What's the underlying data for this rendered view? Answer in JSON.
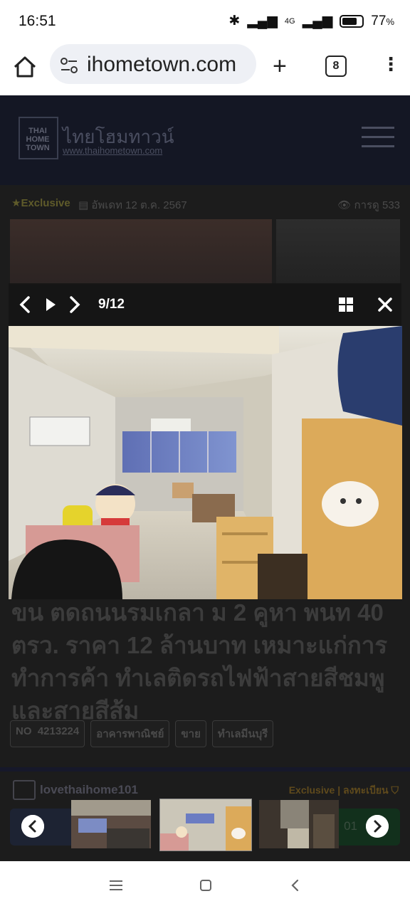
{
  "status": {
    "time": "16:51",
    "battery": "77",
    "battery_suffix": "%",
    "network": "4G"
  },
  "browser": {
    "url": "ihometown.com",
    "tab_count": "8"
  },
  "site": {
    "logo_line1": "THAI",
    "logo_line2": "HOME",
    "logo_line3": "TOWN",
    "name_th": "ไทยโฮมทาวน์",
    "url": "www.thaihometown.com"
  },
  "listing": {
    "exclusive_label": "Exclusive",
    "post_date": "อัพเดท 12 ต.ค. 2567",
    "views": "การดู 533",
    "title_lines": [
      "ขน ตดถนนรมเกลา ม 2 คูหา พนท 40",
      "ตรว. ราคา 12 ล้านบาท เหมาะแก่การ",
      "ทำการค้า ทำเลติดรถไฟฟ้าสายสีชมพู",
      "และสายสีส้ม"
    ],
    "tags": [
      "NO",
      "4213224",
      "อาคารพาณิชย์",
      "ขาย",
      "ทำเลมีนบุรี"
    ],
    "agent_name": "lovethaihome101",
    "agent_badge": "Exclusive | ลงทะเบียน",
    "contact_suffix": "01"
  },
  "gallery": {
    "counter": "9/12"
  },
  "colors": {
    "header_bg": "#141724",
    "overlay_bg": "#1c1c1c",
    "statusbar_bg": "#ffffff"
  }
}
